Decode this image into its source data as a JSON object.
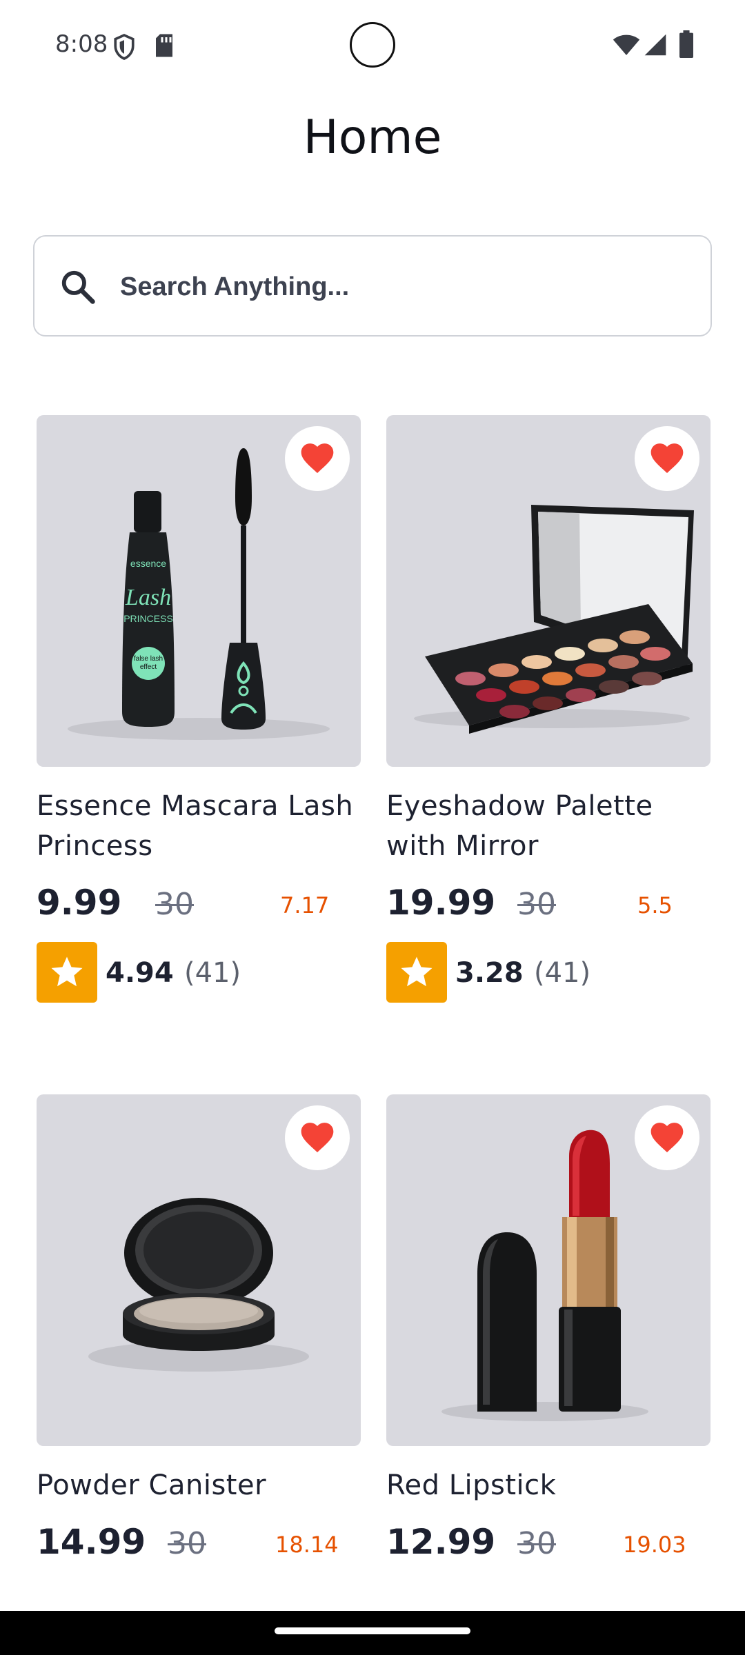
{
  "status_bar": {
    "time": "8:08",
    "icons": [
      "shield-icon",
      "sd-card-icon",
      "wifi-icon",
      "signal-icon",
      "battery-icon"
    ]
  },
  "header": {
    "title": "Home"
  },
  "search": {
    "placeholder": "Search Anything...",
    "value": ""
  },
  "colors": {
    "accent_discount": "#e65100",
    "star_badge": "#f5a000",
    "favorite": "#f44336",
    "card_background": "#d9d9df"
  },
  "products": [
    {
      "name": "Essence Mascara Lash Princess",
      "price": "9.99",
      "old_price": "30",
      "discount": "7.17",
      "rating": "4.94",
      "reviews": "(41)"
    },
    {
      "name": "Eyeshadow Palette with Mirror",
      "price": "19.99",
      "old_price": "30",
      "discount": "5.5",
      "rating": "3.28",
      "reviews": "(41)"
    },
    {
      "name": "Powder Canister",
      "price": "14.99",
      "old_price": "30",
      "discount": "18.14"
    },
    {
      "name": "Red Lipstick",
      "price": "12.99",
      "old_price": "30",
      "discount": "19.03"
    }
  ]
}
